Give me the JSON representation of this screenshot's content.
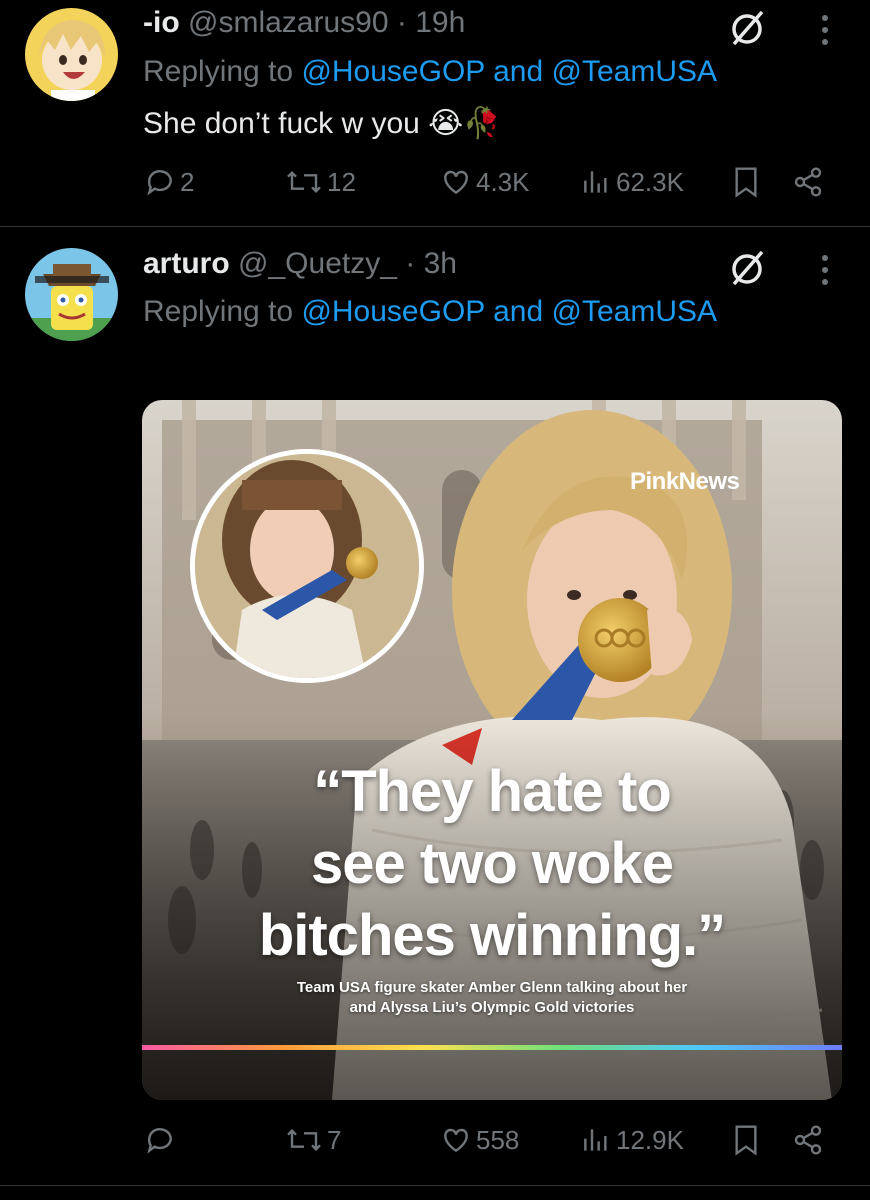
{
  "tweets": [
    {
      "display_name": "-io",
      "handle": "@smlazarus90",
      "time": "· 19h",
      "replying_prefix": "Replying to",
      "mention_1": "@HouseGOP",
      "conjunction": "and",
      "mention_2": "@TeamUSA",
      "text": "She don’t fuck w you 😭🥀",
      "stats": {
        "replies": "2",
        "reposts": "12",
        "likes": "4.3K",
        "views": "62.3K"
      }
    },
    {
      "display_name": "arturo",
      "handle": "@_Quetzy_",
      "time": "· 3h",
      "replying_prefix": "Replying to",
      "mention_1": "@HouseGOP",
      "conjunction": "and",
      "mention_2": "@TeamUSA",
      "media": {
        "brand": "PinkNews",
        "quote_line_1": "“They hate to",
        "quote_line_2": "see two woke",
        "quote_line_3": "bitches winning.”",
        "caption_line_1": "Team USA figure skater Amber Glenn talking about her",
        "caption_line_2": "and Alyssa Liu’s Olympic Gold victories"
      },
      "stats": {
        "replies": "",
        "reposts": "7",
        "likes": "558",
        "views": "12.9K"
      }
    }
  ],
  "colors": {
    "accent": "#1d9bf0",
    "muted": "#71767b",
    "text": "#e7e9ea",
    "background": "#000000"
  }
}
